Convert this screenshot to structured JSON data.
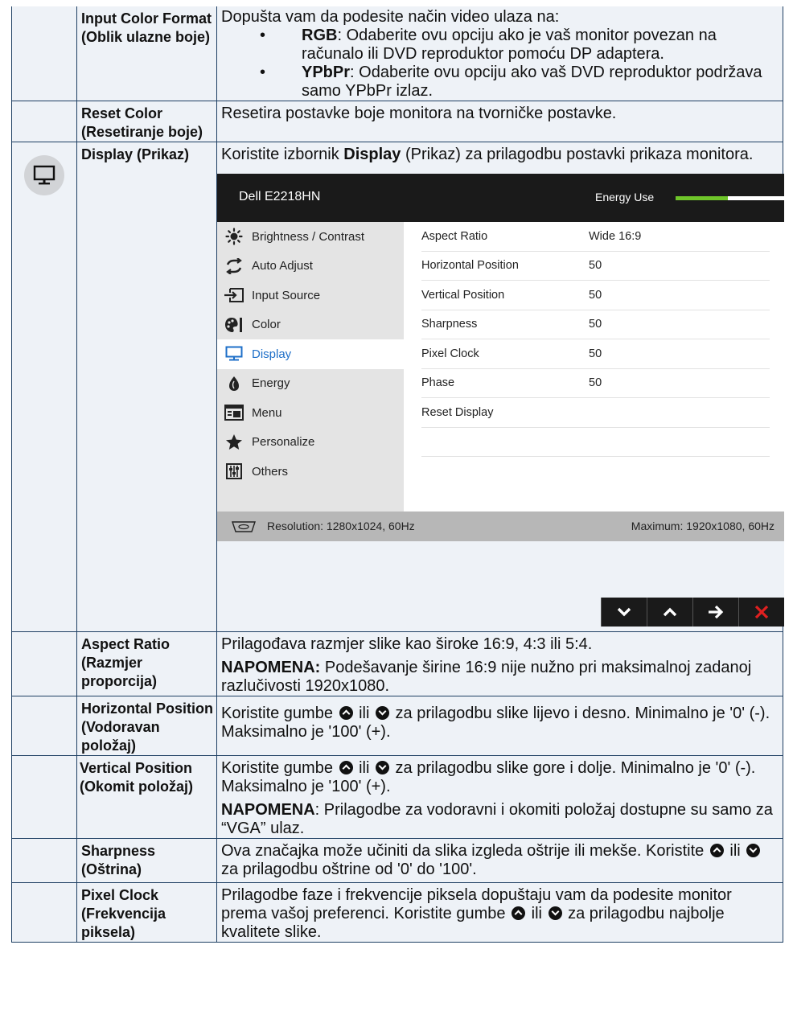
{
  "rows": {
    "input_color_format": {
      "name": "Input Color Format (Oblik ulazne boje)",
      "intro": "Dopušta vam da podesite način video ulaza na:",
      "opt1_term": "RGB",
      "opt1_text": ": Odaberite ovu opciju ako je vaš monitor povezan na računalo ili DVD reproduktor pomoću DP adaptera.",
      "opt2_term": "YPbPr",
      "opt2_text": ": Odaberite ovu opciju ako vaš DVD reproduktor podržava samo YPbPr izlaz."
    },
    "reset_color": {
      "name": "Reset Color (Resetiranje boje)",
      "desc": "Resetira postavke boje monitora na tvorničke postavke."
    },
    "display": {
      "name": "Display (Prikaz)",
      "desc_pre": "Koristite izbornik ",
      "desc_bold": "Display",
      "desc_post": " (Prikaz) za prilagodbu postavki prikaza monitora."
    },
    "aspect_ratio": {
      "name": "Aspect Ratio (Razmjer proporcija)",
      "desc": "Prilagođava razmjer slike kao široke 16:9, 4:3 ili 5:4.",
      "note_label": "NAPOMENA:",
      "note": " Podešavanje širine 16:9 nije nužno pri maksimalnoj zadanoj razlučivosti 1920x1080."
    },
    "horizontal_position": {
      "name": "Horizontal Position (Vodoravan položaj)",
      "d1": "Koristite gumbe ",
      "d2": " ili ",
      "d3": " za prilagodbu slike lijevo i desno. Minimalno je '0' (-). Maksimalno je '100' (+)."
    },
    "vertical_position": {
      "name": "Vertical Position (Okomit položaj)",
      "d1": " Koristite gumbe ",
      "d2": " ili ",
      "d3": " za prilagodbu slike gore i dolje. Minimalno je '0' (-). Maksimalno je '100' (+).",
      "note_label": "NAPOMENA",
      "note": ": Prilagodbe za vodoravni i okomiti položaj dostupne su samo za “VGA” ulaz."
    },
    "sharpness": {
      "name": "Sharpness (Oštrina)",
      "d1": "Ova značajka može učiniti da slika izgleda oštrije ili mekše. Koristite  ",
      "d2": " ili ",
      "d3": " za prilagodbu oštrine od '0' do '100'."
    },
    "pixel_clock": {
      "name": "Pixel Clock (Frekvencija piksela)",
      "d1": "Prilagodbe faze i frekvencije piksela dopuštaju vam da podesite monitor prema vašoj preferenci. Koristite gumbe ",
      "d2": " ili ",
      "d3": " za prilagodbu najbolje kvalitete slike."
    }
  },
  "osd": {
    "model": "Dell E2218HN",
    "energy_label": "Energy Use",
    "energy_level": 0.48,
    "menu": [
      {
        "label": "Brightness / Contrast",
        "icon": "sun-icon"
      },
      {
        "label": "Auto Adjust",
        "icon": "auto-adjust-icon"
      },
      {
        "label": "Input Source",
        "icon": "input-source-icon"
      },
      {
        "label": "Color",
        "icon": "palette-icon"
      },
      {
        "label": "Display",
        "icon": "monitor-icon",
        "active": true
      },
      {
        "label": "Energy",
        "icon": "leaf-icon"
      },
      {
        "label": "Menu",
        "icon": "menu-window-icon"
      },
      {
        "label": "Personalize",
        "icon": "star-icon"
      },
      {
        "label": "Others",
        "icon": "sliders-icon"
      }
    ],
    "submenu": [
      {
        "label": "Aspect Ratio",
        "value": "Wide 16:9"
      },
      {
        "label": "Horizontal Position",
        "value": "50"
      },
      {
        "label": "Vertical Position",
        "value": "50"
      },
      {
        "label": "Sharpness",
        "value": "50"
      },
      {
        "label": "Pixel Clock",
        "value": "50"
      },
      {
        "label": "Phase",
        "value": "50"
      },
      {
        "label": "Reset Display",
        "value": ""
      },
      {
        "label": "",
        "value": ""
      },
      {
        "label": "",
        "value": ""
      }
    ],
    "resolution": "Resolution: 1280x1024, 60Hz",
    "maximum": "Maximum: 1920x1080, 60Hz",
    "accent_color": "#1e6fc8",
    "energy_color": "#6fc52a",
    "close_color": "#e02020"
  }
}
